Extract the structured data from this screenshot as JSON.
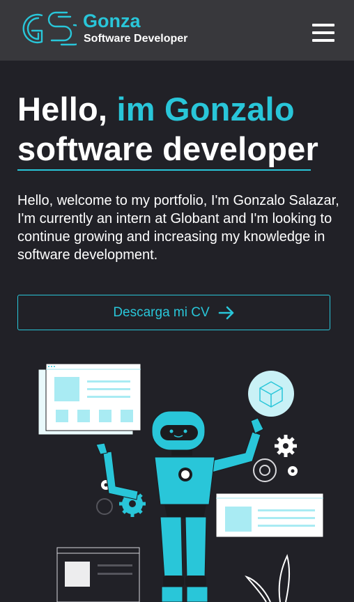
{
  "header": {
    "brand_name": "Gonza",
    "brand_subtitle": "Software Developer",
    "logo_letters": "GS",
    "menu_icon": "hamburger-menu-icon"
  },
  "hero": {
    "title_greeting": "Hello, ",
    "title_name": "im Gonzalo",
    "title_role": "software developer",
    "intro": "Hello, welcome to my portfolio, I'm Gonzalo Salazar, I'm currently an intern at Globant and I'm looking to continue growing and increasing my knowledge in software development.",
    "cv_button_label": "Descarga mi CV",
    "cv_button_icon": "arrow-right-icon",
    "illustration": "robot-developer-illustration"
  },
  "colors": {
    "accent": "#29c6d9",
    "background": "#212127",
    "navbar": "#38383c",
    "text": "#ffffff"
  }
}
